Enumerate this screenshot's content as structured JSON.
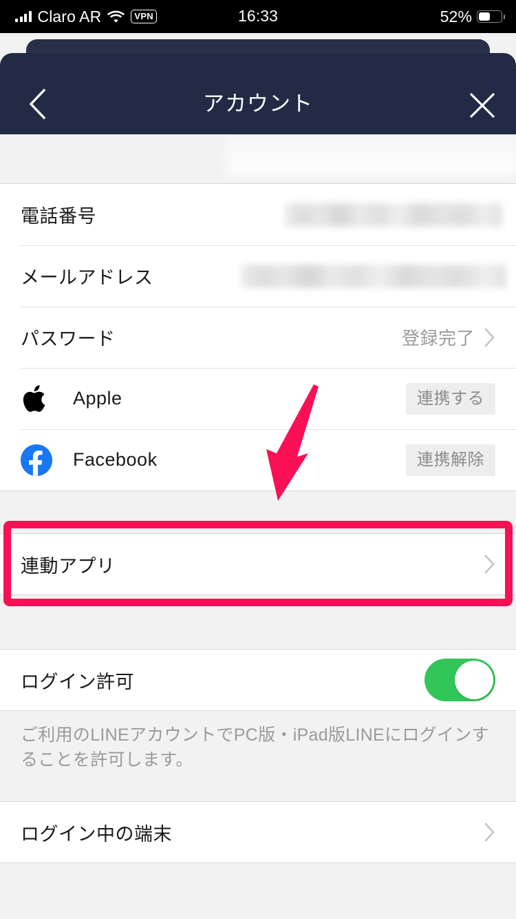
{
  "status_bar": {
    "carrier": "Claro AR",
    "vpn_label": "VPN",
    "time": "16:33",
    "battery_percent": "52%",
    "signal_icon": "cellular-bars-icon",
    "wifi_icon": "wifi-icon",
    "battery_icon": "battery-icon"
  },
  "nav": {
    "title": "アカウント",
    "back_icon": "chevron-left-icon",
    "close_icon": "close-icon",
    "background_color": "#222a45"
  },
  "account_section": {
    "rows": [
      {
        "label": "電話番号",
        "value": "",
        "redacted": true,
        "chevron": false
      },
      {
        "label": "メールアドレス",
        "value": "",
        "redacted": true,
        "chevron": false
      },
      {
        "label": "パスワード",
        "value": "登録完了",
        "redacted": false,
        "chevron": true
      }
    ]
  },
  "linked_services": [
    {
      "icon": "apple-icon",
      "label": "Apple",
      "action_label": "連携する"
    },
    {
      "icon": "facebook-icon",
      "label": "Facebook",
      "action_label": "連携解除"
    }
  ],
  "linked_apps_row": {
    "label": "連動アプリ",
    "chevron_icon": "chevron-right-icon",
    "highlight_color": "#fa1155",
    "highlighted": true
  },
  "login_permission": {
    "label": "ログイン許可",
    "toggle_on": true,
    "toggle_color": "#32c65a",
    "description": "ご利用のLINEアカウントでPC版・iPad版LINEにログインすることを許可します。"
  },
  "logged_in_devices": {
    "label": "ログイン中の端末",
    "chevron_icon": "chevron-right-icon"
  },
  "annotation": {
    "arrow_icon": "pink-arrow-annotation",
    "color": "#fa1155"
  }
}
